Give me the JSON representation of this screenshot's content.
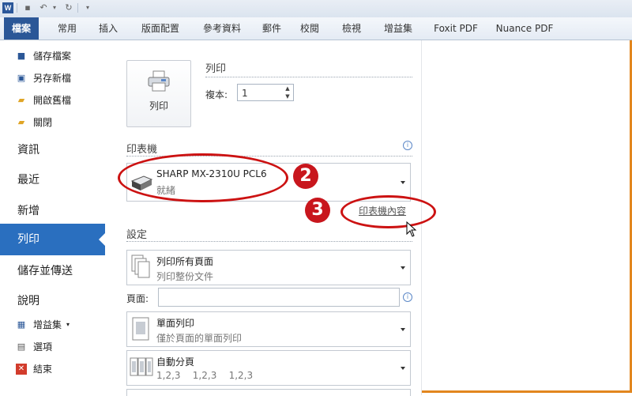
{
  "ribbon": {
    "tabs": [
      "檔案",
      "常用",
      "插入",
      "版面配置",
      "參考資料",
      "郵件",
      "校閱",
      "檢視",
      "增益集",
      "Foxit PDF",
      "Nuance PDF"
    ]
  },
  "nav": {
    "small_top": [
      {
        "label": "儲存檔案",
        "icon": "save-icon"
      },
      {
        "label": "另存新檔",
        "icon": "save-as-icon"
      },
      {
        "label": "開啟舊檔",
        "icon": "open-folder-icon"
      },
      {
        "label": "關閉",
        "icon": "close-folder-icon"
      }
    ],
    "big": [
      "資訊",
      "最近",
      "新增",
      "列印",
      "儲存並傳送",
      "說明"
    ],
    "selected": "列印",
    "small_bottom": [
      {
        "label": "增益集",
        "icon": "addins-icon",
        "has_dropdown": true
      },
      {
        "label": "選項",
        "icon": "options-icon"
      },
      {
        "label": "結束",
        "icon": "exit-icon"
      }
    ]
  },
  "print": {
    "button_label": "列印",
    "section_title": "列印",
    "copies_label": "複本:",
    "copies_value": "1"
  },
  "printer": {
    "section_title": "印表機",
    "name": "SHARP MX-2310U PCL6",
    "status": "就緒",
    "properties_link": "印表機內容"
  },
  "settings": {
    "section_title": "設定",
    "pages_label": "頁面:",
    "pages_value": "",
    "options": [
      {
        "title": "列印所有頁面",
        "subtitle": "列印整份文件",
        "icon": "pages-icon"
      },
      {
        "title": "單面列印",
        "subtitle": "僅於頁面的單面列印",
        "icon": "one-sided-icon"
      },
      {
        "title": "自動分頁",
        "subtitle": "1,2,3    1,2,3    1,2,3",
        "icon": "collate-icon"
      }
    ]
  },
  "annotations": {
    "badge2": "2",
    "badge3": "3"
  },
  "colors": {
    "accent": "#2b5797",
    "nav_selected": "#2a6fbf",
    "annotation_red": "#cc1212",
    "frame_orange": "#e2861e"
  }
}
